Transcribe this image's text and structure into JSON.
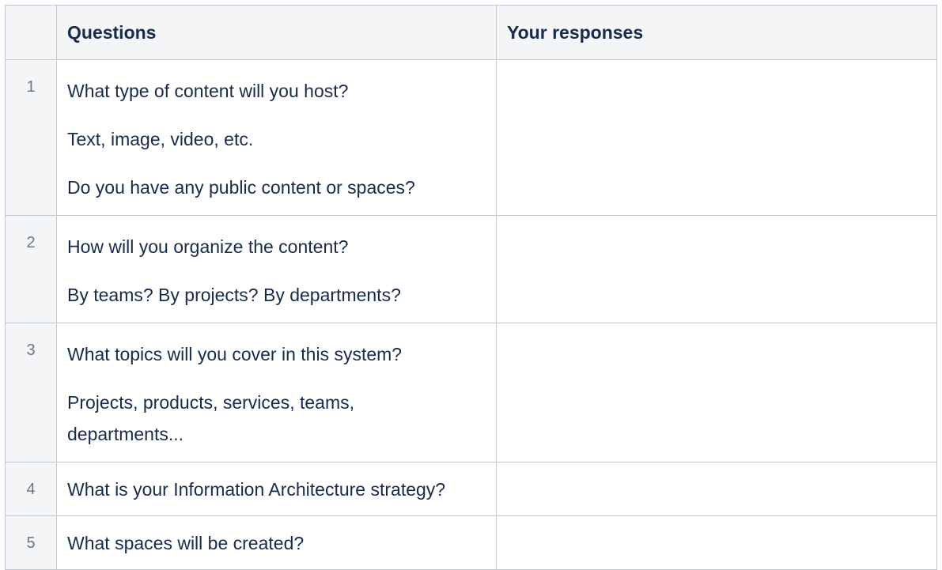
{
  "table": {
    "headers": {
      "number": "",
      "questions": "Questions",
      "responses": "Your responses"
    },
    "rows": [
      {
        "number": "1",
        "lines": [
          "What type of content will you host?",
          "Text, image, video, etc.",
          "Do you have any public content or spaces?"
        ],
        "response": ""
      },
      {
        "number": "2",
        "lines": [
          "How will you organize the content?",
          "By teams? By projects? By departments?"
        ],
        "response": ""
      },
      {
        "number": "3",
        "lines": [
          "What topics will you cover in this system?",
          "Projects, products, services, teams, departments..."
        ],
        "response": ""
      },
      {
        "number": "4",
        "lines": [
          "What is your Information Architecture strategy?"
        ],
        "response": ""
      },
      {
        "number": "5",
        "lines": [
          "What spaces will be created?"
        ],
        "response": ""
      }
    ]
  },
  "colors": {
    "header_bg": "#f4f5f7",
    "border": "#c1c7d0",
    "text": "#172b4d",
    "number_text": "#6b778c"
  }
}
